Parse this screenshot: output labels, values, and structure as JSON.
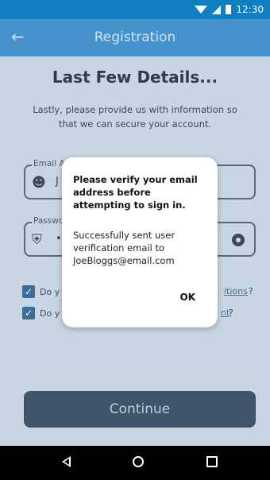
{
  "status_bar": {
    "time": "12:30",
    "icons": [
      "wifi-icon",
      "signal-icon",
      "battery-icon"
    ]
  },
  "app_bar": {
    "title": "Registration",
    "back_icon": "arrow-left-icon"
  },
  "page": {
    "title": "Last Few Details...",
    "subtitle": "Lastly, please provide us with information so that we can secure your account."
  },
  "form": {
    "email": {
      "label": "Email A",
      "value": "J",
      "icon": "person-circle-icon"
    },
    "password": {
      "label": "Passwo",
      "value": "•",
      "icon": "shield-icon",
      "toggle_icon": "eye-icon"
    },
    "checkbox1": {
      "label": "Do y",
      "link_text": "itions",
      "suffix": "?"
    },
    "checkbox2": {
      "label": "Do y",
      "link_text": "nt",
      "suffix": "?"
    }
  },
  "dialog": {
    "title": "Please verify your email address before attempting to sign in.",
    "message": "Successfully sent user verification email to JoeBloggs@email.com",
    "ok_label": "OK"
  },
  "buttons": {
    "continue_label": "Continue"
  },
  "nav_bar": {
    "icons": [
      "nav-back-icon",
      "nav-home-icon",
      "nav-recents-icon"
    ]
  },
  "colors": {
    "status_bar": "#0f7fc2",
    "app_bar": "#4592cc",
    "scrim": "#c7d6e2",
    "continue_button": "#3e5469",
    "checkbox": "#3f6b99"
  }
}
